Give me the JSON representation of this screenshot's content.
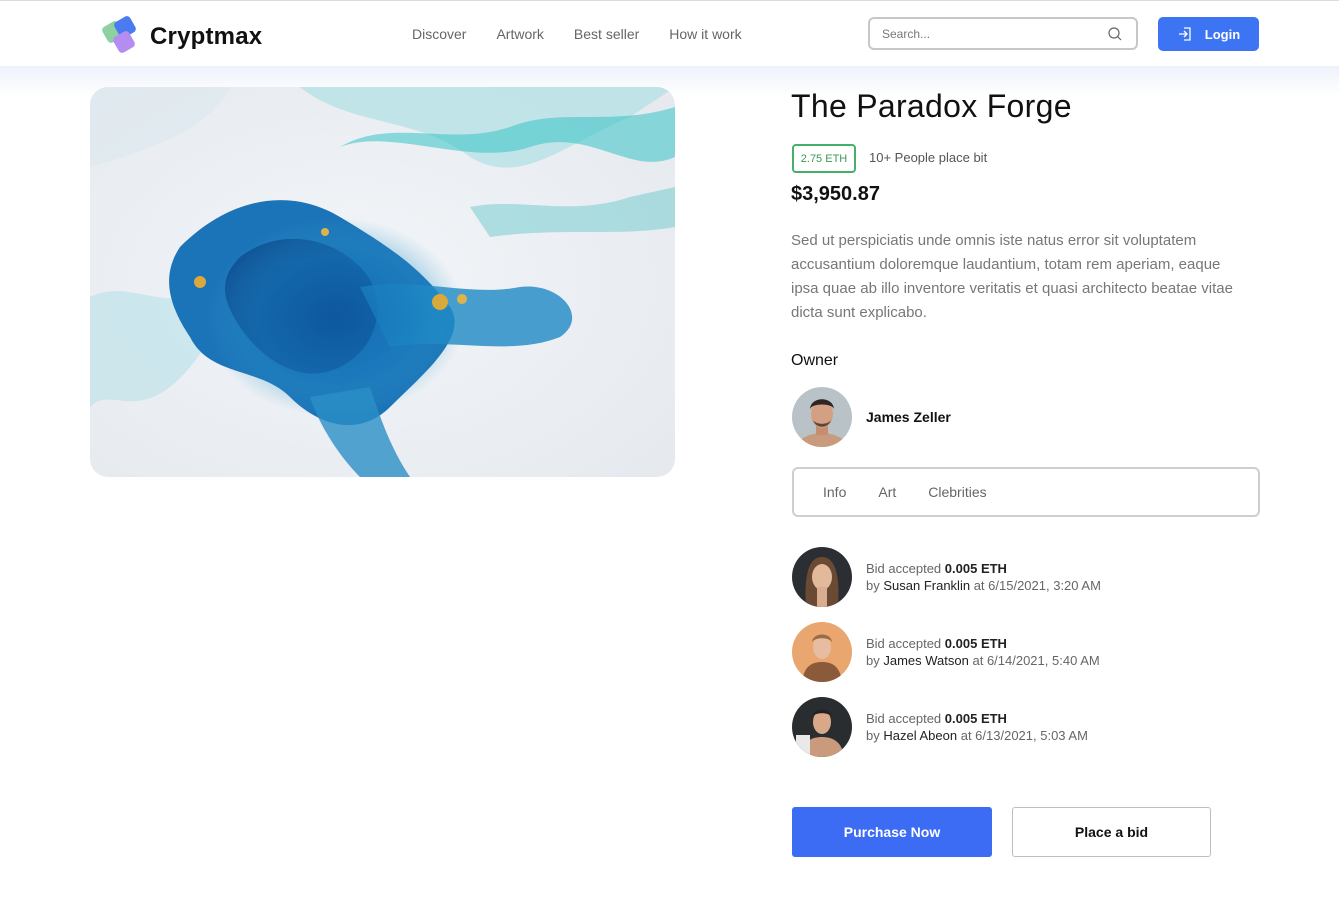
{
  "brand": {
    "name": "Cryptmax"
  },
  "nav": {
    "items": [
      {
        "label": "Discover"
      },
      {
        "label": "Artwork"
      },
      {
        "label": "Best seller"
      },
      {
        "label": "How it work"
      }
    ]
  },
  "search": {
    "placeholder": "Search...",
    "value": ""
  },
  "login": {
    "label": "Login"
  },
  "item": {
    "title": "The Paradox Forge",
    "eth_price": "2.75 ETH",
    "bid_count_text": "10+ People place bit",
    "usd_price": "$3,950.87",
    "description": "Sed ut perspiciatis unde omnis iste natus error sit voluptatem accusantium doloremque laudantium, totam rem aperiam, eaque ipsa quae ab illo inventore veritatis et quasi architecto beatae vitae dicta sunt explicabo."
  },
  "owner": {
    "label": "Owner",
    "name": "James Zeller"
  },
  "tabs": [
    {
      "label": "Info"
    },
    {
      "label": "Art"
    },
    {
      "label": "Clebrities"
    }
  ],
  "bids": [
    {
      "prefix": "Bid accepted",
      "amount": "0.005 ETH",
      "by": "by",
      "name": "Susan Franklin",
      "at": "at 6/15/2021, 3:20 AM"
    },
    {
      "prefix": "Bid accepted",
      "amount": "0.005 ETH",
      "by": "by",
      "name": "James Watson",
      "at": "at 6/14/2021, 5:40 AM"
    },
    {
      "prefix": "Bid accepted",
      "amount": "0.005 ETH",
      "by": "by",
      "name": "Hazel Abeon",
      "at": "at 6/13/2021, 5:03 AM"
    }
  ],
  "actions": {
    "purchase_label": "Purchase Now",
    "bid_label": "Place a bid"
  },
  "colors": {
    "accent": "#3d74f4",
    "eth_green": "#46b06a",
    "text_muted": "#777777"
  },
  "icons": {
    "search": "search-icon",
    "login": "login-icon"
  }
}
